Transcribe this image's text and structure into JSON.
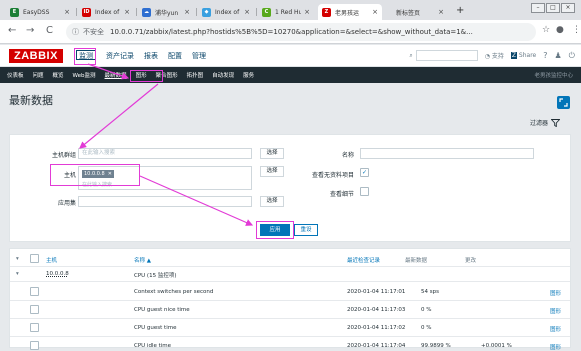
{
  "browser": {
    "tabs": [
      {
        "label": "EasyDSS",
        "fav_color": "#1b7e35",
        "fav_char": "E"
      },
      {
        "label": "Index of",
        "fav_color": "#d40000",
        "fav_char": "ID"
      },
      {
        "label": "浦华yun",
        "fav_color": "#2f6fd1",
        "fav_char": "☁"
      },
      {
        "label": "Index of",
        "fav_color": "#3aa0e0",
        "fav_char": "◆"
      },
      {
        "label": "1 Red Hu",
        "fav_color": "#58a91b",
        "fav_char": "C"
      },
      {
        "label": "老男孩运",
        "fav_color": "#d40000",
        "fav_char": "Z"
      },
      {
        "label": "新标签页",
        "fav_color": "",
        "fav_char": ""
      }
    ],
    "new_tab": "+",
    "security_label": "不安全",
    "url": "10.0.0.71/zabbix/latest.php?hostids%5B%5D=10270&application=&select=&show_without_data=1&..."
  },
  "header": {
    "logo": "ZABBIX",
    "nav": [
      "监测",
      "资产记录",
      "报表",
      "配置",
      "管理"
    ],
    "support": "支持",
    "share": "Share",
    "help": "?"
  },
  "subnav": {
    "items": [
      "仪表板",
      "问题",
      "概览",
      "Web监测",
      "最新数据",
      "图形",
      "聚合图形",
      "拓扑图",
      "自动发现",
      "服务"
    ],
    "right": "老男孩监控中心"
  },
  "page": {
    "title": "最新数据",
    "filter_tab": "过滤器"
  },
  "filter": {
    "host_groups_label": "主机群组",
    "host_groups_placeholder": "在此输入搜索",
    "hosts_label": "主机",
    "host_chip": "10.0.0.8",
    "hosts_placeholder": "在此输入搜索",
    "application_label": "应用集",
    "select_label": "选择",
    "name_label": "名称",
    "show_without_data_label": "查看无资料项目",
    "show_without_data_checked": true,
    "show_details_label": "查看细节",
    "apply": "应用",
    "reset": "重设"
  },
  "table": {
    "headers": {
      "host": "主机",
      "name": "名称 ▲",
      "last_check": "最近检查记录",
      "last_value": "最新数据",
      "change": "更改"
    },
    "host_row": "10.0.0.8",
    "group_row": "CPU (15 监控项)",
    "rows": [
      {
        "name": "Context switches per second",
        "time": "2020-01-04 11:17:01",
        "value": "54 sps",
        "change": "",
        "link": "图形"
      },
      {
        "name": "CPU guest nice time",
        "time": "2020-01-04 11:17:03",
        "value": "0 %",
        "change": "",
        "link": "图形"
      },
      {
        "name": "CPU guest time",
        "time": "2020-01-04 11:17:02",
        "value": "0 %",
        "change": "",
        "link": "图形"
      },
      {
        "name": "CPU idle time",
        "time": "2020-01-04 11:17:04",
        "value": "99.9899 %",
        "change": "+0.0001 %",
        "link": "图形"
      }
    ]
  },
  "colors": {
    "brand_red": "#d40000",
    "link_blue": "#0275b8",
    "annotation_magenta": "#e23bd6",
    "dark_nav": "#1f2c33"
  }
}
